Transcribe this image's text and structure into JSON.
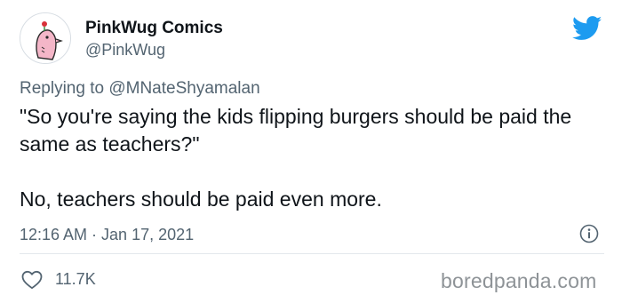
{
  "author": {
    "display_name": "PinkWug Comics",
    "handle": "@PinkWug",
    "avatar_icon": "pinkwug-avatar"
  },
  "platform_icon": "twitter-bird-icon",
  "colors": {
    "twitter_blue": "#1d9bf0",
    "secondary_text": "#536471",
    "primary_text": "#0f1419",
    "divider": "#e3e8ec",
    "avatar_pink": "#f4b6c8"
  },
  "reply": {
    "prefix": "Replying to",
    "mention": "@MNateShyamalan"
  },
  "tweet": {
    "paragraph_1": "\"So you're saying the kids flipping burgers should be paid the same as teachers?\"",
    "paragraph_2": "No, teachers should be paid even more."
  },
  "meta": {
    "timestamp": "12:16 AM · Jan 17, 2021",
    "info_icon": "info-icon"
  },
  "actions": {
    "like_icon": "heart-icon",
    "like_count": "11.7K"
  },
  "watermark": "boredpanda.com"
}
